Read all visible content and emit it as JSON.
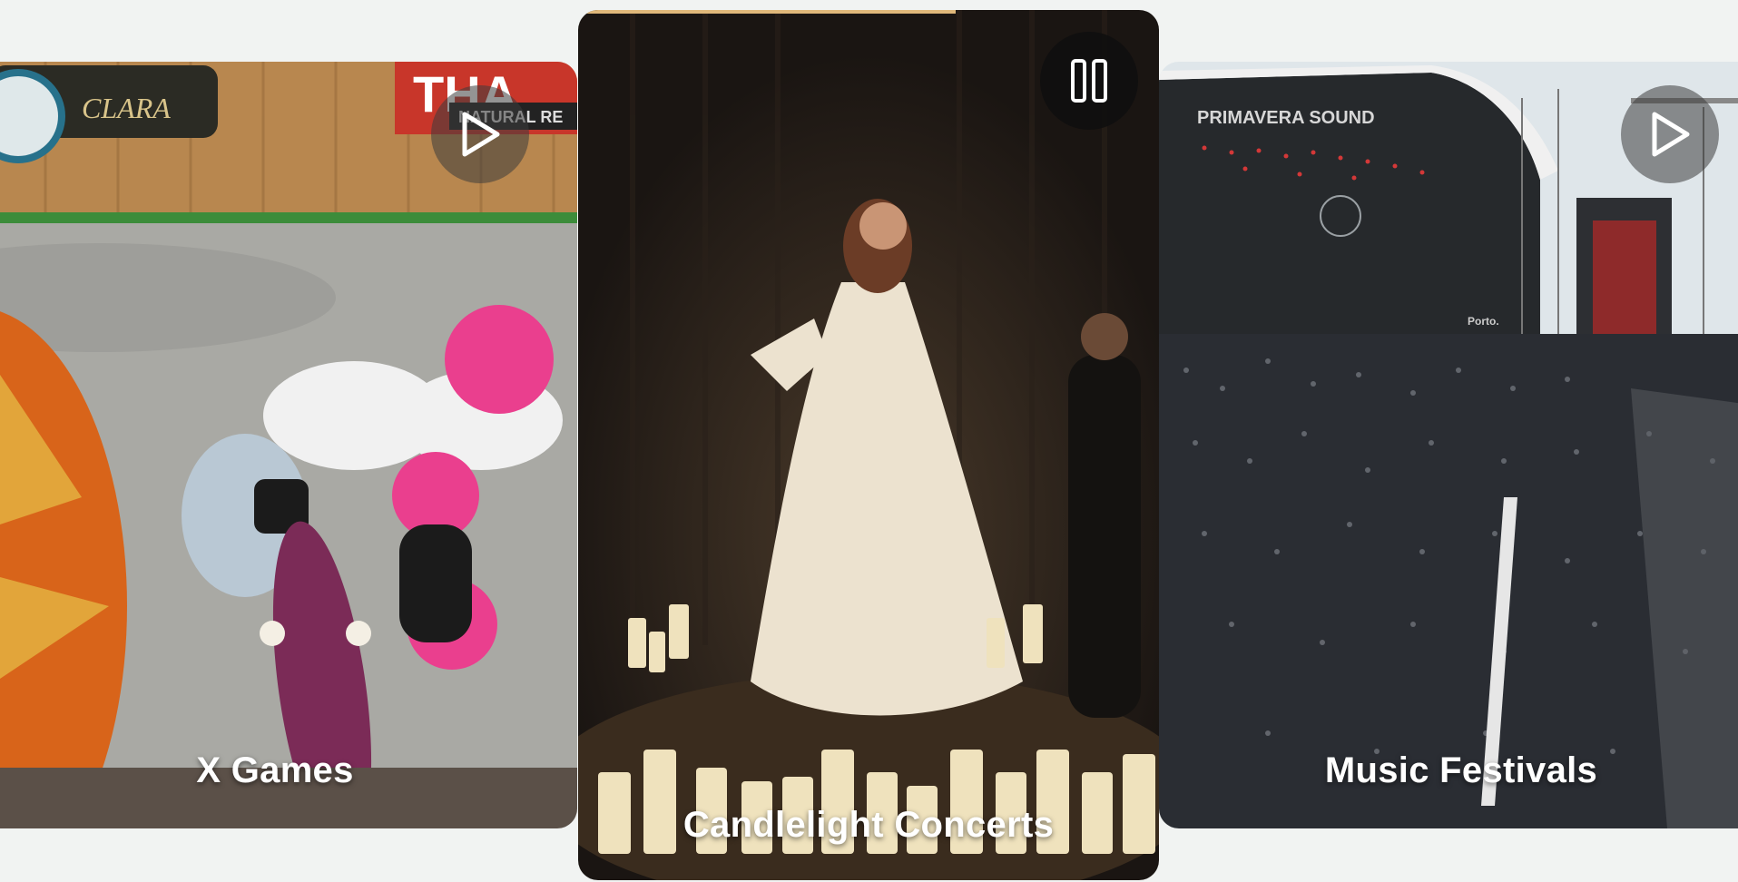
{
  "cards": [
    {
      "title": "X Games",
      "control": "play-icon",
      "sign_text": "CLARA",
      "sign_text_2": "THA",
      "sign_text_3": "NATURAL RE"
    },
    {
      "title": "Candlelight Concerts",
      "control": "pause-icon",
      "progress": 0.65
    },
    {
      "title": "Music Festivals",
      "control": "play-icon",
      "stage_text": "PRIMAVERA  SOUND",
      "stage_text_2": "Porto."
    }
  ],
  "colors": {
    "background": "#f1f3f2",
    "title_text": "#ffffff",
    "progress": "#e0b87a"
  }
}
